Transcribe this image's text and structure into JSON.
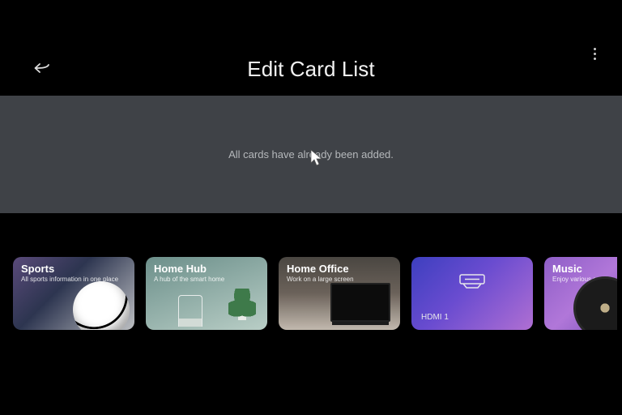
{
  "header": {
    "title": "Edit Card List"
  },
  "message": "All cards have already been added.",
  "cards": [
    {
      "title": "Sports",
      "subtitle": "All sports information in one place"
    },
    {
      "title": "Home Hub",
      "subtitle": "A hub of the smart home"
    },
    {
      "title": "Home Office",
      "subtitle": "Work on a large screen"
    },
    {
      "title": "",
      "subtitle": "",
      "label": "HDMI 1"
    },
    {
      "title": "Music",
      "subtitle": "Enjoy various songs"
    }
  ]
}
